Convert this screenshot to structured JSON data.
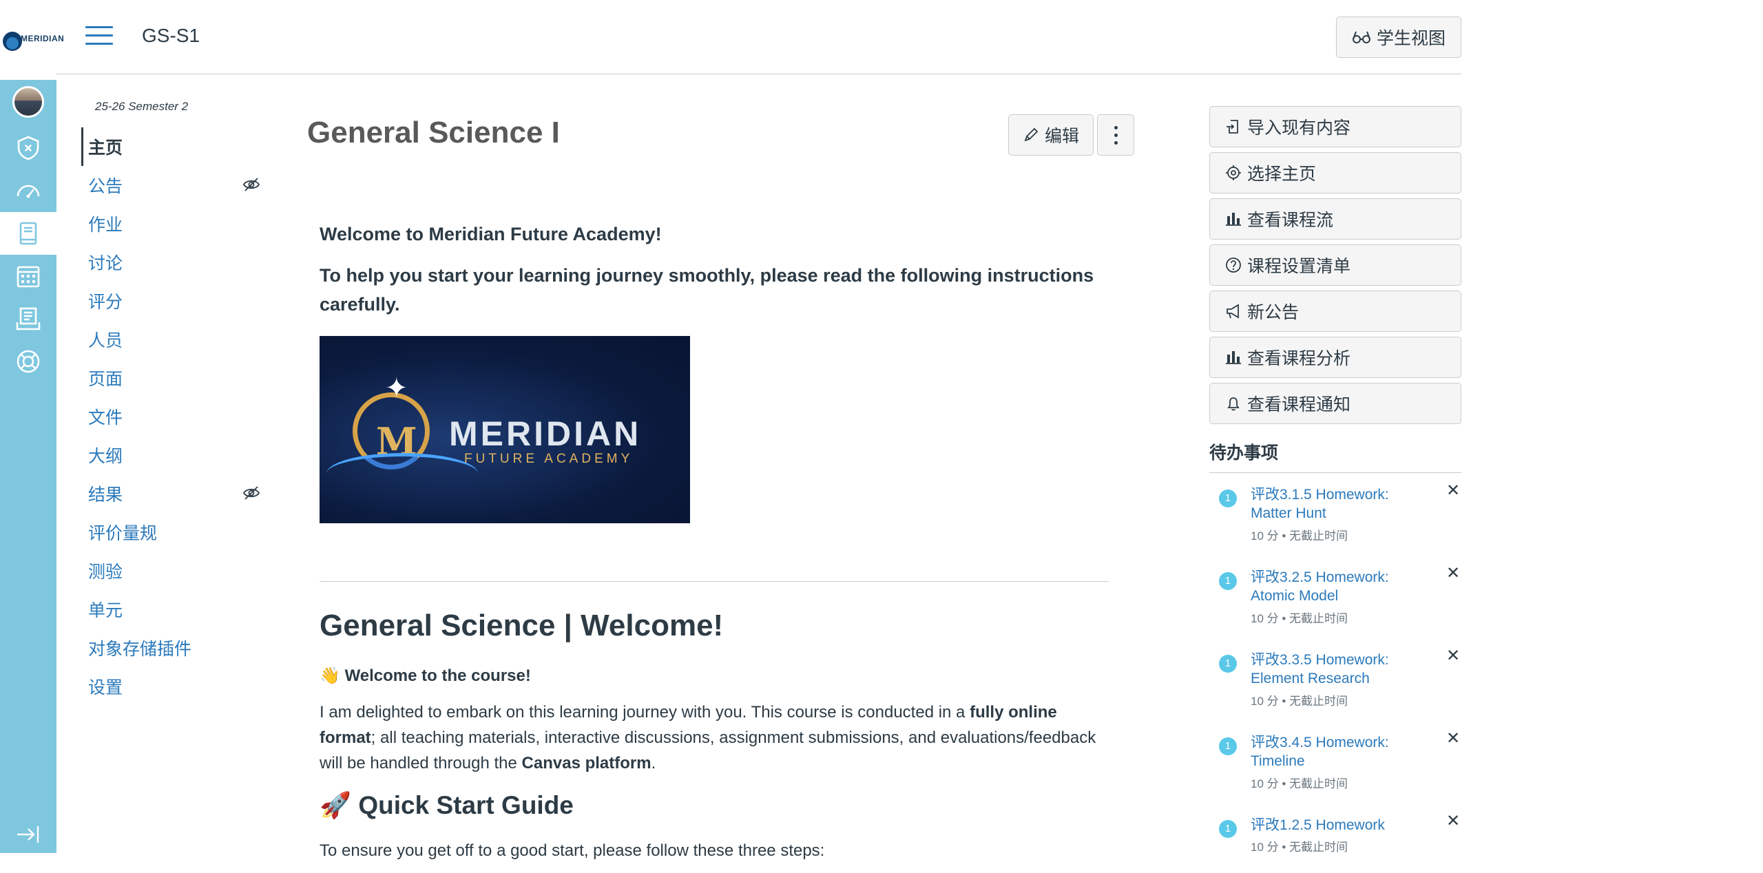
{
  "colors": {
    "global_nav_bg": "#7ec7df",
    "link": "#2b7abc",
    "text": "#2d3b45",
    "todo_badge": "#5ac8e8"
  },
  "global_nav": {
    "logo_text": "MERIDIAN",
    "items": [
      {
        "icon": "avatar"
      },
      {
        "icon": "shield-icon"
      },
      {
        "icon": "dashboard-icon"
      },
      {
        "icon": "courses-icon",
        "active": true
      },
      {
        "icon": "calendar-icon"
      },
      {
        "icon": "inbox-icon"
      },
      {
        "icon": "help-icon"
      },
      {
        "icon": "collapse-icon"
      }
    ]
  },
  "header": {
    "course_code": "GS-S1",
    "student_view": "学生视图"
  },
  "course_nav": {
    "term": "25-26 Semester 2",
    "items": [
      {
        "label": "主页",
        "active": true
      },
      {
        "label": "公告",
        "hidden": true
      },
      {
        "label": "作业"
      },
      {
        "label": "讨论"
      },
      {
        "label": "评分"
      },
      {
        "label": "人员"
      },
      {
        "label": "页面"
      },
      {
        "label": "文件"
      },
      {
        "label": "大纲"
      },
      {
        "label": "结果",
        "hidden": true
      },
      {
        "label": "评价量规"
      },
      {
        "label": "测验"
      },
      {
        "label": "单元"
      },
      {
        "label": "对象存储插件"
      },
      {
        "label": "设置"
      }
    ]
  },
  "main": {
    "title": "General Science I",
    "edit": "编辑",
    "welcome_heading": "Welcome to Meridian Future Academy!",
    "intro_heading": "To help you start your learning journey smoothly, please read the following instructions carefully.",
    "banner": {
      "brand": "MERIDIAN",
      "brand_sub": "FUTURE ACADEMY",
      "monogram": "M"
    },
    "h2": "General Science | Welcome!",
    "course_welcome_emoji": "👋",
    "course_welcome": "Welcome to the course!",
    "para1_a": "I am delighted to embark on this learning journey with you. This course is conducted in a ",
    "para1_b": "fully online format",
    "para1_c": "; all teaching materials, interactive discussions, assignment submissions, and evaluations/feedback will be handled through the ",
    "para1_d": "Canvas platform",
    "para1_e": ".",
    "h3_emoji": "🚀",
    "h3": "Quick Start Guide",
    "para2": "To ensure you get off to a good start, please follow these three steps:"
  },
  "sidebar": {
    "buttons": [
      {
        "label": "导入现有内容",
        "icon": "import-icon"
      },
      {
        "label": "选择主页",
        "icon": "target-icon"
      },
      {
        "label": "查看课程流",
        "icon": "bar-chart-icon"
      },
      {
        "label": "课程设置清单",
        "icon": "question-icon"
      },
      {
        "label": "新公告",
        "icon": "megaphone-icon"
      },
      {
        "label": "查看课程分析",
        "icon": "bar-chart-icon"
      },
      {
        "label": "查看课程通知",
        "icon": "bell-icon"
      }
    ],
    "todo_heading": "待办事项",
    "todos": [
      {
        "badge": "1",
        "title": "评改3.1.5 Homework: Matter Hunt",
        "meta": "10 分 • 无截止时间"
      },
      {
        "badge": "1",
        "title": "评改3.2.5 Homework: Atomic Model",
        "meta": "10 分 • 无截止时间"
      },
      {
        "badge": "1",
        "title": "评改3.3.5 Homework: Element Research",
        "meta": "10 分 • 无截止时间"
      },
      {
        "badge": "1",
        "title": "评改3.4.5 Homework: Timeline",
        "meta": "10 分 • 无截止时间"
      },
      {
        "badge": "1",
        "title": "评改1.2.5 Homework",
        "meta": "10 分 • 无截止时间"
      }
    ],
    "close_glyph": "✕"
  }
}
